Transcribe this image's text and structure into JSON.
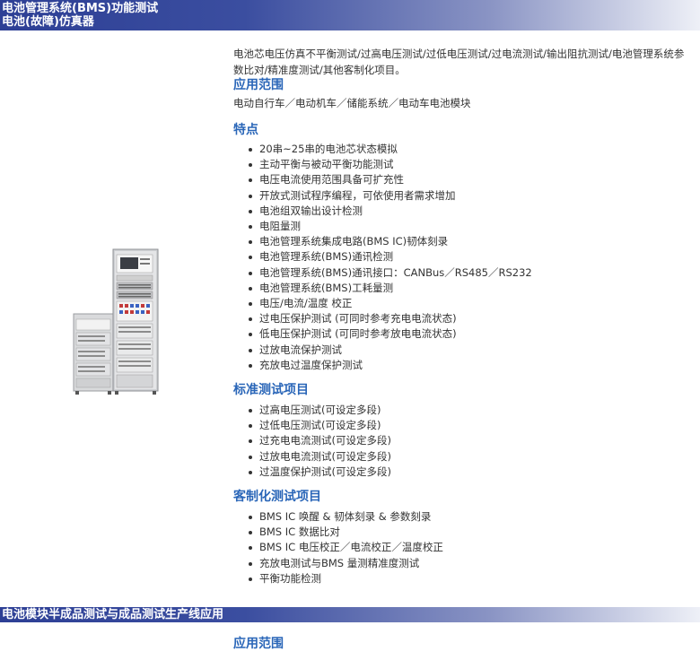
{
  "section1": {
    "banner_line1": "电池管理系统(BMS)功能测试",
    "banner_line2": "电池(故障)仿真器",
    "intro_line1": "电池芯电压仿真不平衡测试/过高电压测试/过低电压测试/过电流测试/输出阻抗测试/电池管理系统参",
    "intro_line2": "数比对/精准度测试/其他客制化项目。",
    "scope_title": "应用范围",
    "scope_text": "电动自行车／电动机车／储能系统／电动车电池模块",
    "features_title": "特点",
    "features": [
      "20串~25串的电池芯状态模拟",
      "主动平衡与被动平衡功能测试",
      "电压电流使用范围具备可扩充性",
      "开放式测试程序编程，可依使用者需求增加",
      "电池组双输出设计检测",
      "电阻量测",
      "电池管理系统集成电路(BMS IC)韧体刻录",
      "电池管理系统(BMS)通讯检测",
      "电池管理系统(BMS)通讯接口：CANBus／RS485／RS232",
      "电池管理系统(BMS)工耗量测",
      "电压/电流/温度 校正",
      "过电压保护测试 (可同时参考充电电流状态)",
      "低电压保护测试 (可同时参考放电电流状态)",
      "过放电流保护测试",
      "充放电过温度保护测试"
    ],
    "standard_title": "标准测试项目",
    "standard_items": [
      "过高电压测试(可设定多段)",
      "过低电压测试(可设定多段)",
      "过充电电流测试(可设定多段)",
      "过放电电流测试(可设定多段)",
      "过温度保护测试(可设定多段)"
    ],
    "custom_title": "客制化测试项目",
    "custom_items": [
      "BMS IC 唤醒 & 韧体刻录 & 参数刻录",
      "BMS IC 数据比对",
      "BMS IC 电压校正／电流校正／温度校正",
      "充放电测试与BMS 量测精准度测试",
      "平衡功能检测"
    ]
  },
  "section2": {
    "banner": "电池模块半成品测试与成品测试生产线应用",
    "scope_title": "应用范围"
  },
  "colors": {
    "banner": "#2d3f95",
    "section_title": "#2a66b8",
    "text": "#333333"
  }
}
